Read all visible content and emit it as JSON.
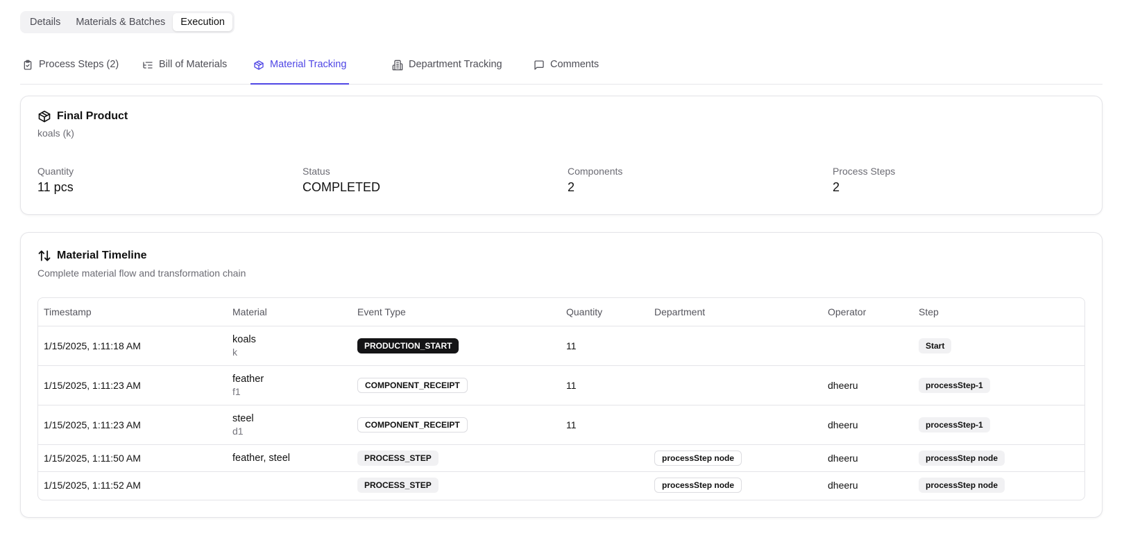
{
  "segment_tabs": [
    {
      "label": "Details",
      "active": false
    },
    {
      "label": "Materials & Batches",
      "active": false
    },
    {
      "label": "Execution",
      "active": true
    }
  ],
  "tabs": [
    {
      "label": "Process Steps (2)",
      "icon": "clipboard-check-icon"
    },
    {
      "label": "Bill of Materials",
      "icon": "list-tree-icon"
    },
    {
      "label": "Material Tracking",
      "icon": "package-icon",
      "active": true
    },
    {
      "label": "Department Tracking",
      "icon": "building-icon"
    },
    {
      "label": "Comments",
      "icon": "message-square-icon"
    }
  ],
  "final_product": {
    "title": "Final Product",
    "subtitle": "koals (k)",
    "stats": [
      {
        "label": "Quantity",
        "value": "11 pcs"
      },
      {
        "label": "Status",
        "value": "COMPLETED"
      },
      {
        "label": "Components",
        "value": "2"
      },
      {
        "label": "Process Steps",
        "value": "2"
      }
    ]
  },
  "timeline": {
    "title": "Material Timeline",
    "subtitle": "Complete material flow and transformation chain",
    "columns": [
      "Timestamp",
      "Material",
      "Event Type",
      "Quantity",
      "Department",
      "Operator",
      "Step"
    ],
    "rows": [
      {
        "timestamp": "1/15/2025, 1:11:18 AM",
        "material": "koals",
        "material_code": "k",
        "event": "PRODUCTION_START",
        "event_style": "dark",
        "quantity": "11",
        "department": "",
        "operator": "",
        "step": "Start"
      },
      {
        "timestamp": "1/15/2025, 1:11:23 AM",
        "material": "feather",
        "material_code": "f1",
        "event": "COMPONENT_RECEIPT",
        "event_style": "outline",
        "quantity": "11",
        "department": "",
        "operator": "dheeru",
        "step": "processStep-1"
      },
      {
        "timestamp": "1/15/2025, 1:11:23 AM",
        "material": "steel",
        "material_code": "d1",
        "event": "COMPONENT_RECEIPT",
        "event_style": "outline",
        "quantity": "11",
        "department": "",
        "operator": "dheeru",
        "step": "processStep-1"
      },
      {
        "timestamp": "1/15/2025, 1:11:50 AM",
        "material": "feather, steel",
        "material_code": "",
        "event": "PROCESS_STEP",
        "event_style": "gray",
        "quantity": "",
        "department": "processStep node",
        "operator": "dheeru",
        "step": "processStep node"
      },
      {
        "timestamp": "1/15/2025, 1:11:52 AM",
        "material": "",
        "material_code": "",
        "event": "PROCESS_STEP",
        "event_style": "gray",
        "quantity": "",
        "department": "processStep node",
        "operator": "dheeru",
        "step": "processStep node"
      }
    ]
  },
  "colors": {
    "accent": "#4f46e5",
    "badge_dark": "#141416"
  }
}
